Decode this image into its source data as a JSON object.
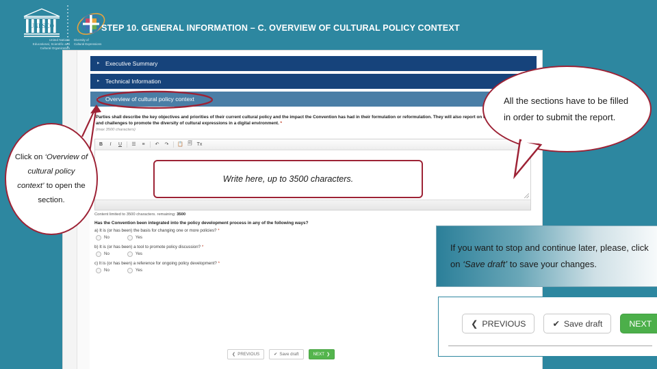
{
  "branding": {
    "unesco_caption": "United Nations\nEducational, Scientific and\nCultural Organization",
    "dce_caption": "Diversity of\nCultural Expressions"
  },
  "header": {
    "title": "STEP 10.  GENERAL INFORMATION – C. OVERVIEW OF CULTURAL POLICY CONTEXT"
  },
  "app": {
    "accordion": [
      {
        "label": "Executive Summary",
        "state": "collapsed",
        "chevron": "chevron-right-icon"
      },
      {
        "label": "Technical Information",
        "state": "collapsed",
        "chevron": "chevron-right-icon"
      },
      {
        "label": "Overview of cultural policy context",
        "state": "expanded",
        "chevron": "chevron-down-icon"
      }
    ],
    "prompt": "Parties shall describe the key objectives and priorities of their current cultural policy and the impact the Convention has had in their formulation or reformulation. They will also report on the opportunities and challenges to promote the diversity of cultural expressions in a digital environment.",
    "required_mark": "*",
    "max_characters_note": "(max 3500 characters)",
    "editor": {
      "toolbar": [
        "B",
        "I",
        "U",
        "☰",
        "≡",
        "↶",
        "↷",
        "📋",
        "🗐",
        "Tx"
      ],
      "value": "",
      "char_limit_note": "Content limited to 3500 characters. remaining:",
      "remaining": "3500"
    },
    "questions": {
      "heading": "Has the Convention been integrated into the policy development process in any of the following ways?",
      "items": [
        {
          "text": "a) It is (or has been) the basis for changing one or more policies?",
          "required": "*",
          "options": [
            "No",
            "Yes"
          ]
        },
        {
          "text": "b) It is (or has been) a tool to promote policy discussion?",
          "required": "*",
          "options": [
            "No",
            "Yes"
          ]
        },
        {
          "text": "c) It is (or has been) a reference for ongoing policy development?",
          "required": "*",
          "options": [
            "No",
            "Yes"
          ]
        }
      ]
    },
    "nav": {
      "previous": "PREVIOUS",
      "save_draft": "Save draft",
      "next": "NEXT"
    }
  },
  "callouts": {
    "sections": "All the sections have to be filled in order to submit the report.",
    "click_overview_pre": "Click on",
    "click_overview_em": "‘Overview of cultural policy context’",
    "click_overview_post": "to open the section.",
    "write_here": "Write here, up to 3500 characters.",
    "save_note_pre": "If you want to stop and continue later, please, click on",
    "save_note_em": "‘Save draft’",
    "save_note_post": "to save your changes."
  },
  "colors": {
    "background_teal": "#2d87a0",
    "accordion_dark": "#16437b",
    "accordion_active": "#4a7ea6",
    "annotation_red": "#9d2235",
    "next_green": "#4caf4a"
  }
}
